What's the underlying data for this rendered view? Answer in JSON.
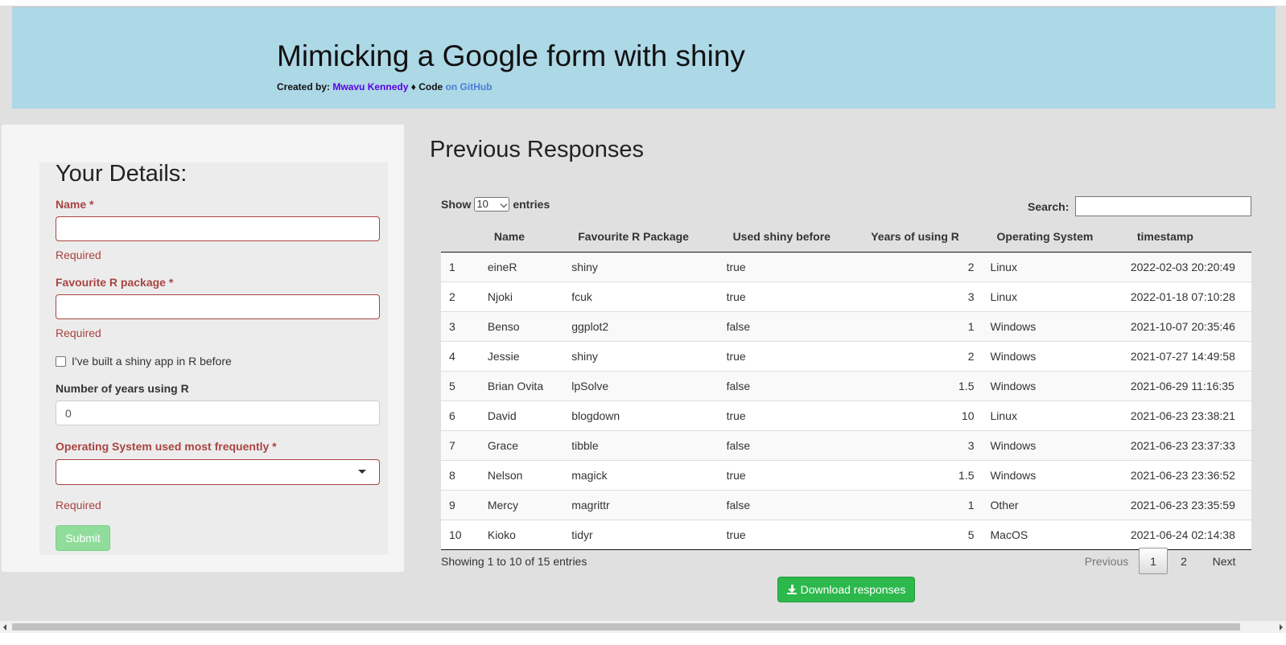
{
  "header": {
    "title": "Mimicking a Google form with shiny",
    "created_by_label": "Created by:",
    "author": "Mwavu Kennedy",
    "separator": "♦",
    "code_label": "Code",
    "code_link": "on GitHub"
  },
  "form": {
    "title": "Your Details:",
    "name_label": "Name *",
    "name_help": "Required",
    "package_label": "Favourite R package *",
    "package_help": "Required",
    "shiny_checkbox_label": "I've built a shiny app in R before",
    "years_label": "Number of years using R",
    "years_value": "0",
    "os_label": "Operating System used most frequently *",
    "os_help": "Required",
    "submit_label": "Submit"
  },
  "responses": {
    "title": "Previous Responses",
    "show_label": "Show",
    "page_length": "10",
    "entries_label": "entries",
    "search_label": "Search:",
    "columns": [
      "",
      "Name",
      "Favourite R Package",
      "Used shiny before",
      "Years of using R",
      "Operating System",
      "timestamp"
    ],
    "rows": [
      [
        "1",
        "eineR",
        "shiny",
        "true",
        "2",
        "Linux",
        "2022-02-03 20:20:49"
      ],
      [
        "2",
        "Njoki",
        "fcuk",
        "true",
        "3",
        "Linux",
        "2022-01-18 07:10:28"
      ],
      [
        "3",
        "Benso",
        "ggplot2",
        "false",
        "1",
        "Windows",
        "2021-10-07 20:35:46"
      ],
      [
        "4",
        "Jessie",
        "shiny",
        "true",
        "2",
        "Windows",
        "2021-07-27 14:49:58"
      ],
      [
        "5",
        "Brian Ovita",
        "lpSolve",
        "false",
        "1.5",
        "Windows",
        "2021-06-29 11:16:35"
      ],
      [
        "6",
        "David",
        "blogdown",
        "true",
        "10",
        "Linux",
        "2021-06-23 23:38:21"
      ],
      [
        "7",
        "Grace",
        "tibble",
        "false",
        "3",
        "Windows",
        "2021-06-23 23:37:33"
      ],
      [
        "8",
        "Nelson",
        "magick",
        "true",
        "1.5",
        "Windows",
        "2021-06-23 23:36:52"
      ],
      [
        "9",
        "Mercy",
        "magrittr",
        "false",
        "1",
        "Other",
        "2021-06-23 23:35:59"
      ],
      [
        "10",
        "Kioko",
        "tidyr",
        "true",
        "5",
        "MacOS",
        "2021-06-24 02:14:38"
      ]
    ],
    "info": "Showing 1 to 10 of 15 entries",
    "pagination": {
      "previous": "Previous",
      "pages": [
        "1",
        "2"
      ],
      "current": "1",
      "next": "Next"
    },
    "download_label": "Download responses",
    "download_icon": "download-icon"
  },
  "colors": {
    "header_bg": "#add8e6",
    "error": "#a94442",
    "success": "#2db84c",
    "author_link": "#5a00e6"
  }
}
